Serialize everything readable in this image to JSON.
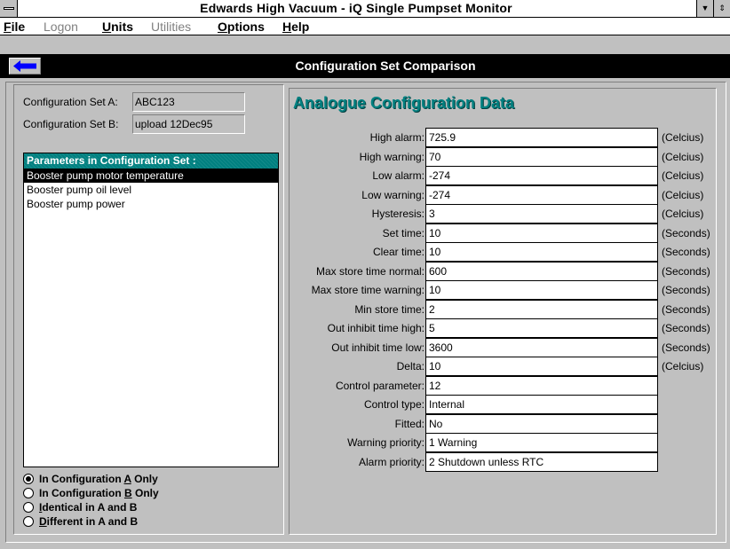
{
  "window": {
    "title": "Edwards High Vacuum - iQ  Single  Pumpset  Monitor"
  },
  "menu": [
    {
      "label": "File",
      "accel": "F",
      "rest": "ile",
      "enabled": true
    },
    {
      "label": "Logon",
      "accel": "",
      "rest": "Logon",
      "enabled": false
    },
    {
      "label": "Units",
      "accel": "U",
      "rest": "nits",
      "enabled": true
    },
    {
      "label": "Utilities",
      "accel": "",
      "rest": "Utilities",
      "enabled": false
    },
    {
      "label": "Options",
      "accel": "O",
      "rest": "ptions",
      "enabled": true
    },
    {
      "label": "Help",
      "accel": "H",
      "rest": "elp",
      "enabled": true
    }
  ],
  "header": {
    "title": "Configuration Set Comparison"
  },
  "config": {
    "set_a_label": "Configuration Set A:",
    "set_a_value": "ABC123",
    "set_b_label": "Configuration Set B:",
    "set_b_value": "upload 12Dec95"
  },
  "params": {
    "heading": "Parameters in Configuration Set :",
    "items": [
      "Booster pump motor temperature",
      "Booster pump oil level",
      "Booster pump power"
    ],
    "selected_index": 0
  },
  "filter": {
    "options": [
      {
        "pre": "In Configuration ",
        "accel": "A",
        "post": " Only"
      },
      {
        "pre": "In Configuration ",
        "accel": "B",
        "post": " Only"
      },
      {
        "pre": "",
        "accel": "I",
        "post": "dentical in A and B"
      },
      {
        "pre": "",
        "accel": "D",
        "post": "ifferent in A and B"
      }
    ],
    "selected_index": 0
  },
  "analogue": {
    "heading": "Analogue Configuration Data",
    "fields": [
      {
        "label": "High alarm:",
        "value": "725.9",
        "unit": "(Celcius)"
      },
      {
        "label": "High warning:",
        "value": "70",
        "unit": "(Celcius)"
      },
      {
        "label": "Low alarm:",
        "value": "-274",
        "unit": "(Celcius)"
      },
      {
        "label": "Low warning:",
        "value": "-274",
        "unit": "(Celcius)"
      },
      {
        "label": "Hysteresis:",
        "value": "3",
        "unit": "(Celcius)"
      },
      {
        "label": "Set time:",
        "value": "10",
        "unit": "(Seconds)"
      },
      {
        "label": "Clear time:",
        "value": "10",
        "unit": "(Seconds)"
      },
      {
        "label": "Max store time normal:",
        "value": "600",
        "unit": "(Seconds)"
      },
      {
        "label": "Max store time warning:",
        "value": "10",
        "unit": "(Seconds)"
      },
      {
        "label": "Min store time:",
        "value": "2",
        "unit": "(Seconds)"
      },
      {
        "label": "Out inhibit time high:",
        "value": "5",
        "unit": "(Seconds)"
      },
      {
        "label": "Out inhibit time low:",
        "value": "3600",
        "unit": "(Seconds)"
      },
      {
        "label": "Delta:",
        "value": "10",
        "unit": "(Celcius)"
      },
      {
        "label": "Control parameter:",
        "value": "12",
        "unit": ""
      },
      {
        "label": "Control type:",
        "value": "Internal",
        "unit": ""
      },
      {
        "label": "Fitted:",
        "value": "No",
        "unit": ""
      },
      {
        "label": "Warning priority:",
        "value": "1 Warning",
        "unit": ""
      },
      {
        "label": "Alarm priority:",
        "value": "2 Shutdown unless RTC",
        "unit": ""
      }
    ]
  },
  "colors": {
    "accent": "#008080",
    "face": "#c0c0c0"
  }
}
